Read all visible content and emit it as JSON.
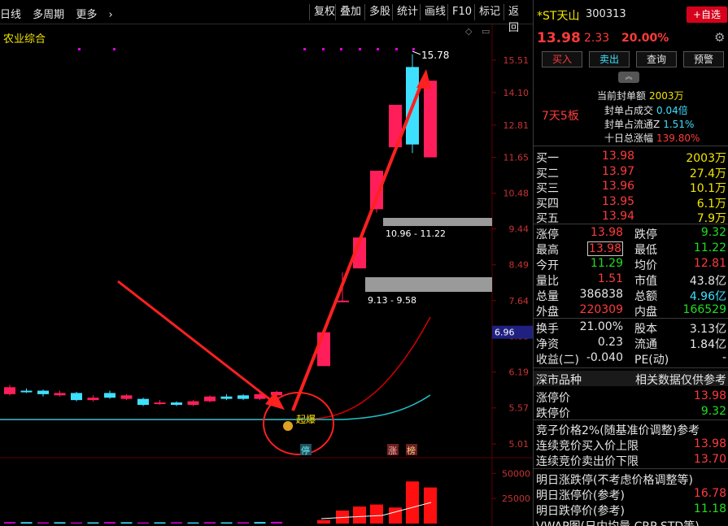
{
  "toolbar": {
    "period": "日线",
    "multi_period": "多周期",
    "more": "更多",
    "buttons": [
      "复权",
      "叠加",
      "多股",
      "统计",
      "画线",
      "F10",
      "标记",
      "返回"
    ]
  },
  "chart": {
    "sector_label": "农业综合",
    "max_label": "15.78",
    "current_price_tag": "6.96",
    "y_ticks": [
      "15.51",
      "14.10",
      "12.81",
      "11.65",
      "10.48",
      "9.44",
      "8.49",
      "7.64",
      "6.88",
      "6.19",
      "5.57",
      "5.01"
    ],
    "vol_ticks": [
      "50000",
      "25000"
    ],
    "zone1_label": "10.96 - 11.22",
    "zone2_label": "9.13 - 9.58",
    "signal_label": "起爆",
    "badge1": "涨",
    "badge2": "榜",
    "badge_ting": "停",
    "colors": {
      "up": "#ff1e5a",
      "down": "#3ee0ff",
      "ma1": "#d40000",
      "ma2": "#20c0c8",
      "arrow": "#ff2020"
    }
  },
  "chart_data": {
    "type": "candlestick",
    "candles": [
      {
        "o": 5.8,
        "c": 5.92,
        "h": 5.96,
        "l": 5.78,
        "up": true
      },
      {
        "o": 5.86,
        "c": 5.86,
        "h": 5.9,
        "l": 5.82,
        "up": false
      },
      {
        "o": 5.86,
        "c": 5.8,
        "h": 5.88,
        "l": 5.76,
        "up": false
      },
      {
        "o": 5.78,
        "c": 5.82,
        "h": 5.86,
        "l": 5.76,
        "up": true
      },
      {
        "o": 5.82,
        "c": 5.7,
        "h": 5.84,
        "l": 5.68,
        "up": false
      },
      {
        "o": 5.7,
        "c": 5.74,
        "h": 5.78,
        "l": 5.68,
        "up": true
      },
      {
        "o": 5.74,
        "c": 5.82,
        "h": 5.86,
        "l": 5.72,
        "up": false
      },
      {
        "o": 5.78,
        "c": 5.72,
        "h": 5.8,
        "l": 5.7,
        "up": true
      },
      {
        "o": 5.72,
        "c": 5.62,
        "h": 5.74,
        "l": 5.6,
        "up": false
      },
      {
        "o": 5.64,
        "c": 5.66,
        "h": 5.7,
        "l": 5.62,
        "up": true
      },
      {
        "o": 5.66,
        "c": 5.62,
        "h": 5.68,
        "l": 5.6,
        "up": false
      },
      {
        "o": 5.62,
        "c": 5.68,
        "h": 5.7,
        "l": 5.6,
        "up": true
      },
      {
        "o": 5.68,
        "c": 5.76,
        "h": 5.78,
        "l": 5.66,
        "up": true
      },
      {
        "o": 5.76,
        "c": 5.72,
        "h": 5.8,
        "l": 5.7,
        "up": false
      },
      {
        "o": 5.72,
        "c": 5.78,
        "h": 5.8,
        "l": 5.7,
        "up": false
      },
      {
        "o": 5.72,
        "c": 5.8,
        "h": 5.84,
        "l": 5.7,
        "up": true
      },
      {
        "o": 5.78,
        "c": 5.84,
        "h": 5.86,
        "l": 5.76,
        "up": true
      },
      {
        "o": 6.3,
        "c": 6.96,
        "h": 6.96,
        "l": 6.3,
        "up": true
      },
      {
        "o": 7.64,
        "c": 7.64,
        "h": 8.3,
        "l": 7.6,
        "up": true
      },
      {
        "o": 8.4,
        "c": 9.2,
        "h": 9.2,
        "l": 8.4,
        "up": true
      },
      {
        "o": 10.0,
        "c": 11.2,
        "h": 11.2,
        "l": 9.9,
        "up": true
      },
      {
        "o": 12.0,
        "c": 13.6,
        "h": 13.6,
        "l": 11.9,
        "up": true
      },
      {
        "o": 12.1,
        "c": 15.2,
        "h": 15.78,
        "l": 11.8,
        "up": false
      },
      {
        "o": 14.6,
        "c": 11.65,
        "h": 14.6,
        "l": 11.65,
        "up": true
      }
    ],
    "volumes": [
      1500,
      1400,
      1200,
      1300,
      1100,
      1200,
      1500,
      1300,
      1100,
      1200,
      1300,
      1100,
      1400,
      1200,
      1300,
      1500,
      1700,
      3500,
      13000,
      17000,
      19000,
      16000,
      42000,
      36000
    ],
    "y_ticks": [
      15.51,
      14.1,
      12.81,
      11.65,
      10.48,
      9.44,
      8.49,
      7.64,
      6.88,
      6.19,
      5.57,
      5.01
    ],
    "vol_ticks": [
      50000,
      25000
    ]
  },
  "panel": {
    "name": "*ST天山",
    "code": "300313",
    "add_label": "+自选",
    "price": "13.98",
    "change": "2.33",
    "change_pct": "20.00%",
    "buttons": [
      "买入",
      "卖出",
      "查询",
      "预警"
    ],
    "tag": "7天5板",
    "seal": [
      {
        "label": "当前封单额",
        "value": "2003万"
      },
      {
        "label": "封单占成交",
        "value": "0.04倍"
      },
      {
        "label": "封单占流通Z",
        "value": "1.51%"
      },
      {
        "label": "十日总涨幅",
        "value": "139.80%"
      }
    ],
    "bids": [
      {
        "label": "买一",
        "price": "13.98",
        "vol": "2003万"
      },
      {
        "label": "买二",
        "price": "13.97",
        "vol": "27.4万"
      },
      {
        "label": "买三",
        "price": "13.96",
        "vol": "10.1万"
      },
      {
        "label": "买四",
        "price": "13.95",
        "vol": "6.1万"
      },
      {
        "label": "买五",
        "price": "13.94",
        "vol": "7.9万"
      }
    ],
    "stats": [
      {
        "l1": "涨停",
        "v1": "13.98",
        "l2": "跌停",
        "v2": "9.32"
      },
      {
        "l1": "最高",
        "v1": "13.98",
        "l2": "最低",
        "v2": "11.22"
      },
      {
        "l1": "今开",
        "v1": "11.29",
        "l2": "均价",
        "v2": "12.81"
      },
      {
        "l1": "量比",
        "v1": "1.51",
        "l2": "市值",
        "v2": "43.8亿"
      },
      {
        "l1": "总量",
        "v1": "386838",
        "l2": "总额",
        "v2": "4.96亿"
      },
      {
        "l1": "外盘",
        "v1": "220309",
        "l2": "内盘",
        "v2": "166529"
      }
    ],
    "stats2": [
      {
        "l1": "换手",
        "v1": "21.00%",
        "l2": "股本",
        "v2": "3.13亿"
      },
      {
        "l1": "净资",
        "v1": "0.23",
        "l2": "流通",
        "v2": "1.84亿"
      },
      {
        "l1": "收益(二)",
        "v1": "-0.040",
        "l2": "PE(动)",
        "v2": "-"
      }
    ],
    "market": "深市品种",
    "market_note": "相关数据仅供参考",
    "limit_up_label": "涨停价",
    "limit_up": "13.98",
    "limit_down_label": "跌停价",
    "limit_down": "9.32",
    "auction_note": "竞子价格2%(随基准价调整)参考",
    "auction_buy_label": "连续竞价买入价上限",
    "auction_buy": "13.98",
    "auction_sell_label": "连续竞价卖出价下限",
    "auction_sell": "13.70",
    "tomorrow_label": "明日涨跌停(不考虑价格调整等)",
    "tomorrow_up_label": "明日涨停价(参考)",
    "tomorrow_up": "16.78",
    "tomorrow_down_label": "明日跌停价(参考)",
    "tomorrow_down": "11.18",
    "vwap_label": "VWAP图(日内均量 CRP STD等)"
  }
}
